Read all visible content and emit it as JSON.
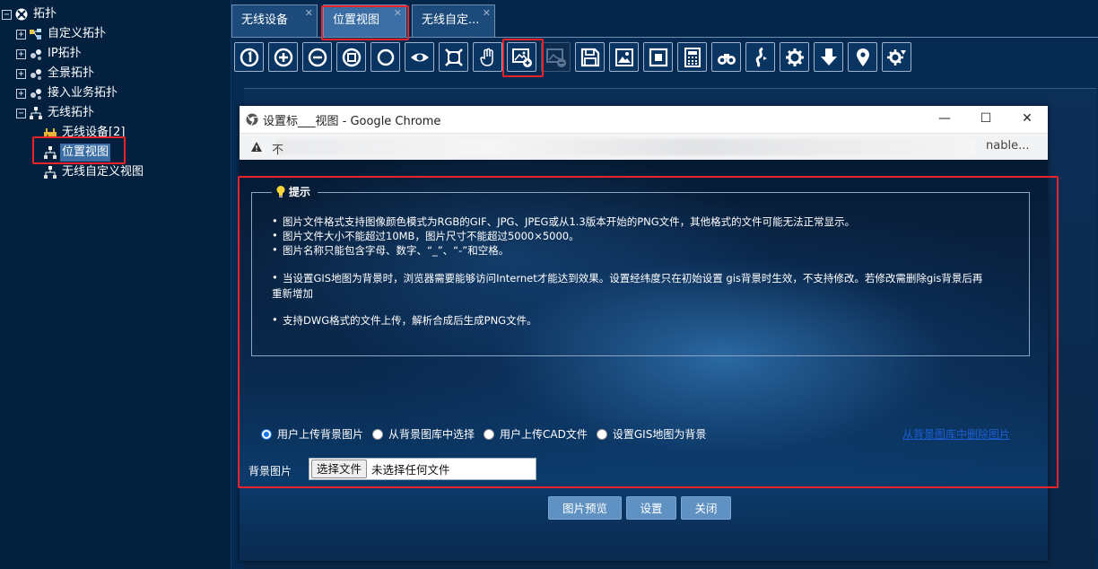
{
  "tree": {
    "root": "拓扑",
    "items": [
      {
        "label": "自定义拓扑",
        "expand": "+"
      },
      {
        "label": "IP拓扑",
        "expand": "+"
      },
      {
        "label": "全景拓扑",
        "expand": "+"
      },
      {
        "label": "接入业务拓扑",
        "expand": "+"
      },
      {
        "label": "无线拓扑",
        "expand": "−"
      }
    ],
    "wireless_children": [
      {
        "label": "无线设备[2]"
      },
      {
        "label": "位置视图"
      },
      {
        "label": "无线自定义视图"
      }
    ],
    "root_expand": "−"
  },
  "tabs": [
    {
      "label": "无线设备"
    },
    {
      "label": "位置视图"
    },
    {
      "label": "无线自定..."
    }
  ],
  "tab_close": "✕",
  "toolbar_icons": [
    "reset-view-icon",
    "zoom-in-icon",
    "zoom-out-icon",
    "fit-icon",
    "circle-icon",
    "eye-icon",
    "fullscreen-icon",
    "hand-icon",
    "add-background-icon",
    "remove-background-icon",
    "save-icon",
    "image-icon",
    "frame-icon",
    "calculator-icon",
    "binoculars-icon",
    "connect-icon",
    "gear-icon",
    "download-icon",
    "location-icon",
    "settings-cog-icon"
  ],
  "popup": {
    "title": "设置标___视图 - Google Chrome",
    "url_prefix": "不",
    "url_suffix": "nable...",
    "controls": {
      "minimize": "—",
      "maximize": "☐",
      "close": "✕"
    }
  },
  "tips": {
    "legend": "提示",
    "lines": [
      "图片文件格式支持图像颜色模式为RGB的GIF、JPG、JPEG或从1.3版本开始的PNG文件，其他格式的文件可能无法正常显示。",
      "图片文件大小不能超过10MB，图片尺寸不能超过5000×5000。",
      "图片名称只能包含字母、数字、“_”、“-”和空格。",
      "当设置GIS地图为背景时，浏览器需要能够访问Internet才能达到效果。设置经纬度只在初始设置 gis背景时生效，不支持修改。若修改需删除gis背景后再",
      "重新增加",
      "支持DWG格式的文件上传，解析合成后生成PNG文件。"
    ]
  },
  "radios": [
    {
      "label": "用户上传背景图片",
      "checked": true
    },
    {
      "label": "从背景图库中选择",
      "checked": false
    },
    {
      "label": "用户上传CAD文件",
      "checked": false
    },
    {
      "label": "设置GIS地图为背景",
      "checked": false
    }
  ],
  "delete_link": "从背景图库中删除图片",
  "file": {
    "label": "背景图片",
    "button": "选择文件",
    "none": "未选择任何文件"
  },
  "buttons": {
    "preview": "图片预览",
    "set": "设置",
    "close": "关闭"
  },
  "colors": {
    "highlight_box": "#e8232a",
    "selected_tab": "#3a6ea5",
    "link": "#1b5fd1"
  }
}
